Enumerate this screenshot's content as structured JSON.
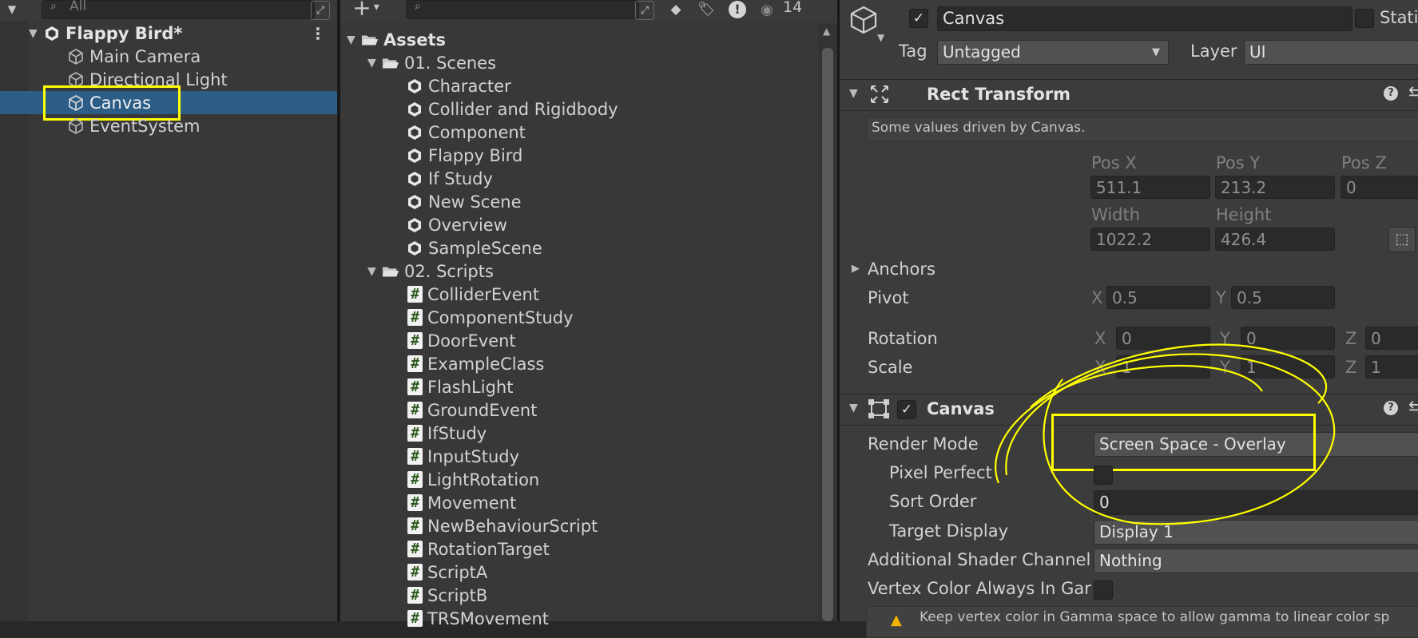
{
  "hierarchy": {
    "search_placeholder": "All",
    "scene_name": "Flappy Bird*",
    "items": [
      {
        "label": "Main Camera"
      },
      {
        "label": "Directional Light"
      },
      {
        "label": "Canvas"
      },
      {
        "label": "EventSystem"
      }
    ]
  },
  "project": {
    "hidden_count": "14",
    "root": "Assets",
    "folder_scenes": "01. Scenes",
    "scenes": [
      "Character",
      "Collider and Rigidbody",
      "Component",
      "Flappy Bird",
      "If Study",
      "New Scene",
      "Overview",
      "SampleScene"
    ],
    "folder_scripts": "02. Scripts",
    "scripts": [
      "ColliderEvent",
      "ComponentStudy",
      "DoorEvent",
      "ExampleClass",
      "FlashLight",
      "GroundEvent",
      "IfStudy",
      "InputStudy",
      "LightRotation",
      "Movement",
      "NewBehaviourScript",
      "RotationTarget",
      "ScriptA",
      "ScriptB",
      "TRSMovement"
    ]
  },
  "inspector": {
    "object_name": "Canvas",
    "static_label": "Stati",
    "tag_label": "Tag",
    "tag_value": "Untagged",
    "layer_label": "Layer",
    "layer_value": "UI",
    "rect_transform": {
      "title": "Rect Transform",
      "note": "Some values driven by Canvas.",
      "pos_x_label": "Pos X",
      "pos_y_label": "Pos Y",
      "pos_z_label": "Pos Z",
      "pos_x": "511.1",
      "pos_y": "213.2",
      "pos_z": "0",
      "width_label": "Width",
      "height_label": "Height",
      "width": "1022.2",
      "height": "426.4",
      "anchors_label": "Anchors",
      "pivot_label": "Pivot",
      "pivot_x": "0.5",
      "pivot_y": "0.5",
      "rotation_label": "Rotation",
      "rot_x": "0",
      "rot_y": "0",
      "rot_z": "0",
      "scale_label": "Scale",
      "scale_x": "1",
      "scale_y": "1",
      "scale_z": "1",
      "x": "X",
      "y": "Y",
      "z": "Z"
    },
    "canvas": {
      "title": "Canvas",
      "render_mode_label": "Render Mode",
      "render_mode_value": "Screen Space - Overlay",
      "pixel_perfect_label": "Pixel Perfect",
      "sort_order_label": "Sort Order",
      "sort_order_value": "0",
      "target_display_label": "Target Display",
      "target_display_value": "Display 1",
      "shader_channel_label": "Additional Shader Channel",
      "shader_channel_value": "Nothing",
      "vertex_color_label": "Vertex Color Always In Gar",
      "warning": "Keep vertex color in Gamma space to allow gamma to linear color sp"
    }
  },
  "colors": {
    "selection": "#2c5d87",
    "highlight": "#ffff00",
    "panel": "#383838"
  }
}
